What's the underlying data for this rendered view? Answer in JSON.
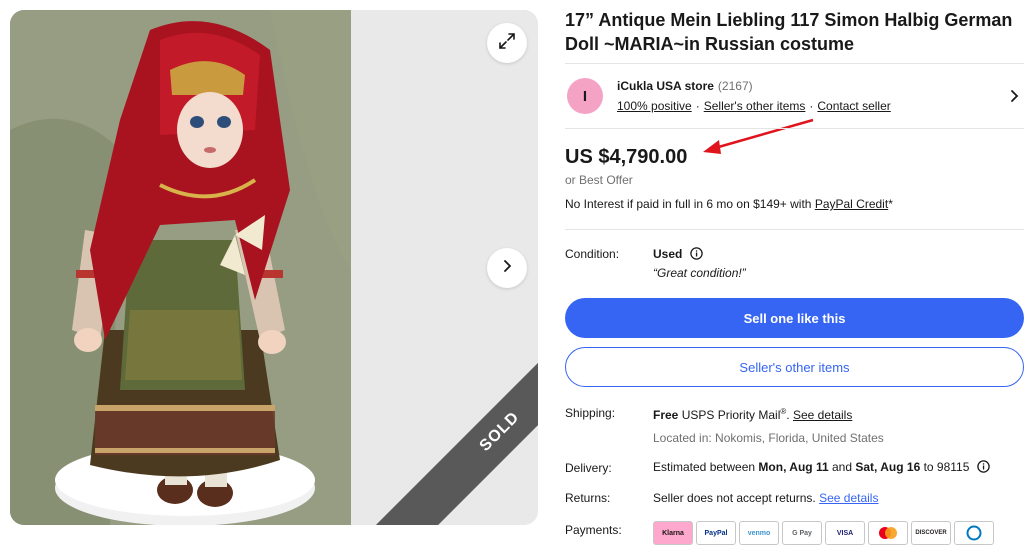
{
  "gallery": {
    "sold_label": "SOLD",
    "expand_icon": "expand-icon",
    "next_icon": "chevron-right-icon"
  },
  "listing": {
    "title": "17” Antique Mein Liebling 117 Simon Halbig German Doll ~MARIA~in Russian costume"
  },
  "seller": {
    "avatar_letter": "I",
    "name": "iCukla USA store",
    "count": "(2167)",
    "positive": "100% positive",
    "other_items": "Seller's other items",
    "contact": "Contact seller",
    "sep": "·"
  },
  "price": {
    "amount": "US $4,790.00",
    "offer": "or Best Offer",
    "credit_text": "No Interest if paid in full in 6 mo on $149+ with ",
    "credit_link": "PayPal Credit",
    "credit_mark": "*"
  },
  "condition": {
    "label": "Condition:",
    "value": "Used",
    "quote": "“Great condition!”"
  },
  "buttons": {
    "sell_one": "Sell one like this",
    "sellers_items": "Seller's other items"
  },
  "shipping": {
    "label": "Shipping:",
    "free": "Free",
    "service": " USPS Priority Mail",
    "reg": "®",
    "dot": ". ",
    "details_link": "See details",
    "location": "Located in: Nokomis, Florida, United States"
  },
  "delivery": {
    "label": "Delivery:",
    "prefix": "Estimated between ",
    "start": "Mon, Aug 11",
    "and": " and ",
    "end": "Sat, Aug 16",
    "suffix": " to 98115"
  },
  "returns": {
    "label": "Returns:",
    "text": "Seller does not accept returns. ",
    "details_link": "See details"
  },
  "payments": {
    "label": "Payments:",
    "methods": [
      "Klarna",
      "PayPal",
      "venmo",
      "G Pay",
      "VISA",
      "MC",
      "DISCOVER",
      "Diners"
    ]
  },
  "colors": {
    "primary": "#3665f3",
    "annotation_arrow": "#e0141c",
    "sold_ribbon": "#595959",
    "avatar": "#f5a3c5"
  }
}
